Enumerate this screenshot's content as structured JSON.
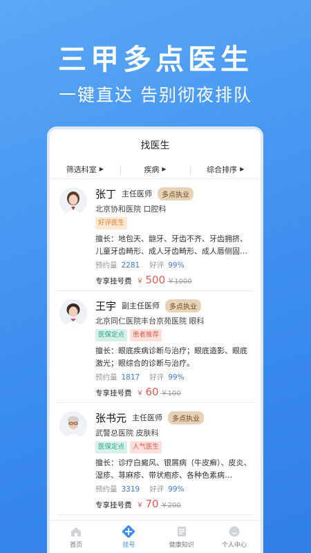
{
  "hero": {
    "title": "三甲多点医生",
    "subtitle": "一键直达  告别彻夜排队"
  },
  "screen": {
    "title": "找医生"
  },
  "filters": [
    {
      "label": "筛选科室"
    },
    {
      "label": "疾病"
    },
    {
      "label": "综合排序"
    }
  ],
  "labels": {
    "booking": "预约量",
    "rating": "好评",
    "fee": "专享挂号费",
    "currency": "￥"
  },
  "doctors": [
    {
      "name": "张丁",
      "title": "主任医师",
      "badge": "多点执业",
      "hospital": "北京协和医院  口腔科",
      "tags": [
        "好评医生"
      ],
      "specialty": "擅长：地包天、龅牙、牙齿不齐、牙齿拥挤、儿童牙齿畸形、成人牙齿畸形、成人唇侧固…",
      "bookings": "2281",
      "rating": "99%",
      "price": "500",
      "old_price": "￥1000"
    },
    {
      "name": "王宇",
      "title": "副主任医师",
      "badge": "多点执业",
      "hospital": "北京同仁医院丰台京苑医院  眼科",
      "tags": [
        "医保定点",
        "患者推荐"
      ],
      "specialty": "擅长：眼底疾病诊断与治疗；眼底造影、眼底激光；眼综合的诊断与治疗。",
      "bookings": "1817",
      "rating": "99%",
      "price": "60",
      "old_price": "￥100"
    },
    {
      "name": "张书元",
      "title": "主任医师",
      "badge": "多点执业",
      "hospital": "武警总医院  皮肤科",
      "tags": [
        "医保定点",
        "人气医生"
      ],
      "specialty": "擅长：诊疗白癜风、银屑病（牛皮癣）、皮炎、湿疹、荨麻疹、带状疱疹、各种色素病…",
      "bookings": "3319",
      "rating": "99%",
      "price": "70",
      "old_price": "￥200"
    }
  ],
  "tabbar": [
    {
      "label": "首页",
      "icon": "home-icon"
    },
    {
      "label": "挂号",
      "icon": "register-icon"
    },
    {
      "label": "健康知识",
      "icon": "knowledge-icon"
    },
    {
      "label": "个人中心",
      "icon": "profile-icon"
    }
  ],
  "colors": {
    "brand": "#3d8ef0",
    "price": "#e45a4e",
    "badge": "#e6d3b7"
  }
}
